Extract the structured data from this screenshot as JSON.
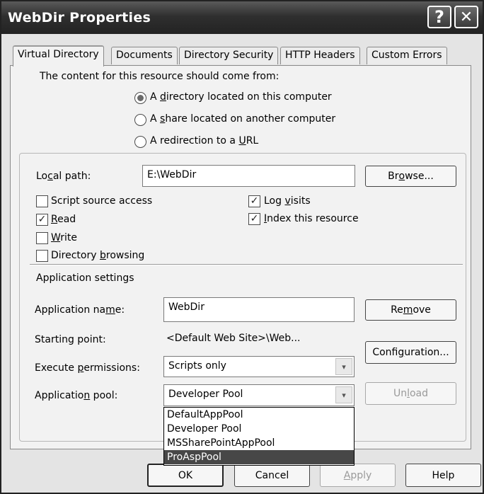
{
  "window": {
    "title": "WebDir Properties",
    "help_btn": "?",
    "close_btn": "✕"
  },
  "tabs": [
    {
      "label": "Virtual Directory",
      "active": true
    },
    {
      "label": "Documents"
    },
    {
      "label": "Directory Security"
    },
    {
      "label": "HTTP Headers"
    },
    {
      "label": "Custom Errors"
    }
  ],
  "source": {
    "heading": "The content for this resource should come from:",
    "options": [
      {
        "pre": "A ",
        "key": "d",
        "post": "irectory located on this computer",
        "selected": true
      },
      {
        "pre": "A ",
        "key": "s",
        "post": "hare located on another computer",
        "selected": false
      },
      {
        "pre": "A redirection to a ",
        "key": "U",
        "post": "RL",
        "selected": false
      }
    ]
  },
  "local_path": {
    "label_pre": "Lo",
    "label_key": "c",
    "label_post": "al path:",
    "value": "E:\\WebDir",
    "browse_pre": "Br",
    "browse_key": "o",
    "browse_post": "wse..."
  },
  "checkboxes": {
    "script_source": {
      "label": "Script source access",
      "checked": false
    },
    "read": {
      "key": "R",
      "post": "ead",
      "checked": true
    },
    "write": {
      "key": "W",
      "post": "rite",
      "checked": false
    },
    "dir_browsing": {
      "pre": "Directory ",
      "key": "b",
      "post": "rowsing",
      "checked": false
    },
    "log_visits": {
      "pre": "Log ",
      "key": "v",
      "post": "isits",
      "checked": true
    },
    "index": {
      "key": "I",
      "post": "ndex this resource",
      "checked": true
    },
    "check_glyph": "✓"
  },
  "app_settings": {
    "heading": "Application settings",
    "name_label_pre": "Application na",
    "name_label_key": "m",
    "name_label_post": "e:",
    "name_value": "WebDir",
    "remove_pre": "Re",
    "remove_key": "m",
    "remove_post": "ove",
    "starting_label": "Starting point:",
    "starting_value": "<Default Web Site>\\Web...",
    "config_pre": "Confi",
    "config_key": "g",
    "config_post": "uration...",
    "exec_label_pre": "Execute ",
    "exec_label_key": "p",
    "exec_label_post": "ermissions:",
    "exec_value": "Scripts only",
    "pool_label_pre": "Applicatio",
    "pool_label_key": "n",
    "pool_label_post": " pool:",
    "pool_value": "Developer Pool",
    "unload_pre": "Un",
    "unload_key": "l",
    "unload_post": "oad",
    "pool_options": [
      "DefaultAppPool",
      "Developer Pool",
      "MSSharePointAppPool",
      "ProAspPool"
    ],
    "pool_highlighted": "ProAspPool"
  },
  "footer": {
    "ok": "OK",
    "cancel": "Cancel",
    "apply_key": "A",
    "apply_post": "pply",
    "help": "Help"
  },
  "icons": {
    "chevron": "▾"
  }
}
